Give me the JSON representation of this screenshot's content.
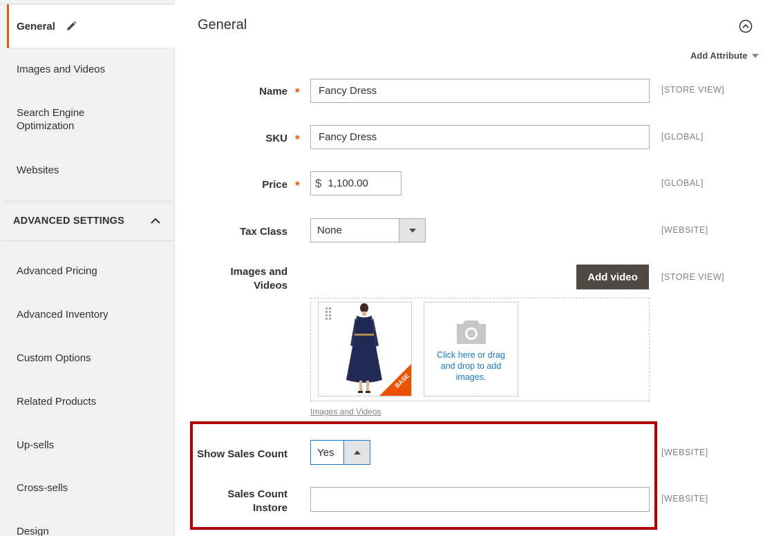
{
  "sidebar": {
    "items_top": [
      {
        "label": "General",
        "active": true
      },
      {
        "label": "Images and Videos"
      },
      {
        "label": "Search Engine Optimization"
      },
      {
        "label": "Websites"
      }
    ],
    "advanced_header": "ADVANCED SETTINGS",
    "items_advanced": [
      {
        "label": "Advanced Pricing"
      },
      {
        "label": "Advanced Inventory"
      },
      {
        "label": "Custom Options"
      },
      {
        "label": "Related Products"
      },
      {
        "label": "Up-sells"
      },
      {
        "label": "Cross-sells"
      },
      {
        "label": "Design"
      }
    ]
  },
  "main": {
    "title": "General",
    "add_attribute": "Add Attribute",
    "fields": {
      "name": {
        "label": "Name",
        "value": "Fancy Dress",
        "scope": "[STORE VIEW]"
      },
      "sku": {
        "label": "SKU",
        "value": "Fancy Dress",
        "scope": "[GLOBAL]"
      },
      "price": {
        "label": "Price",
        "currency": "$",
        "value": "1,100.00",
        "scope": "[GLOBAL]"
      },
      "tax_class": {
        "label": "Tax Class",
        "value": "None",
        "scope": "[WEBSITE]"
      },
      "images": {
        "label_line1": "Images and",
        "label_line2": "Videos",
        "scope": "[STORE VIEW]",
        "add_video": "Add video",
        "upload_text": "Click here or drag and drop to add images.",
        "link": "Images and Videos",
        "badge": "BASE"
      },
      "show_sales_count": {
        "label": "Show Sales Count",
        "value": "Yes",
        "scope": "[WEBSITE]"
      },
      "sales_count_instore": {
        "label_line1": "Sales Count",
        "label_line2": "Instore",
        "value": "",
        "scope": "[WEBSITE]"
      }
    },
    "required_mark": "*"
  },
  "colors": {
    "accent": "#eb5202",
    "highlight": "#b30000",
    "link": "#1979c3",
    "button_dark": "#514943"
  }
}
